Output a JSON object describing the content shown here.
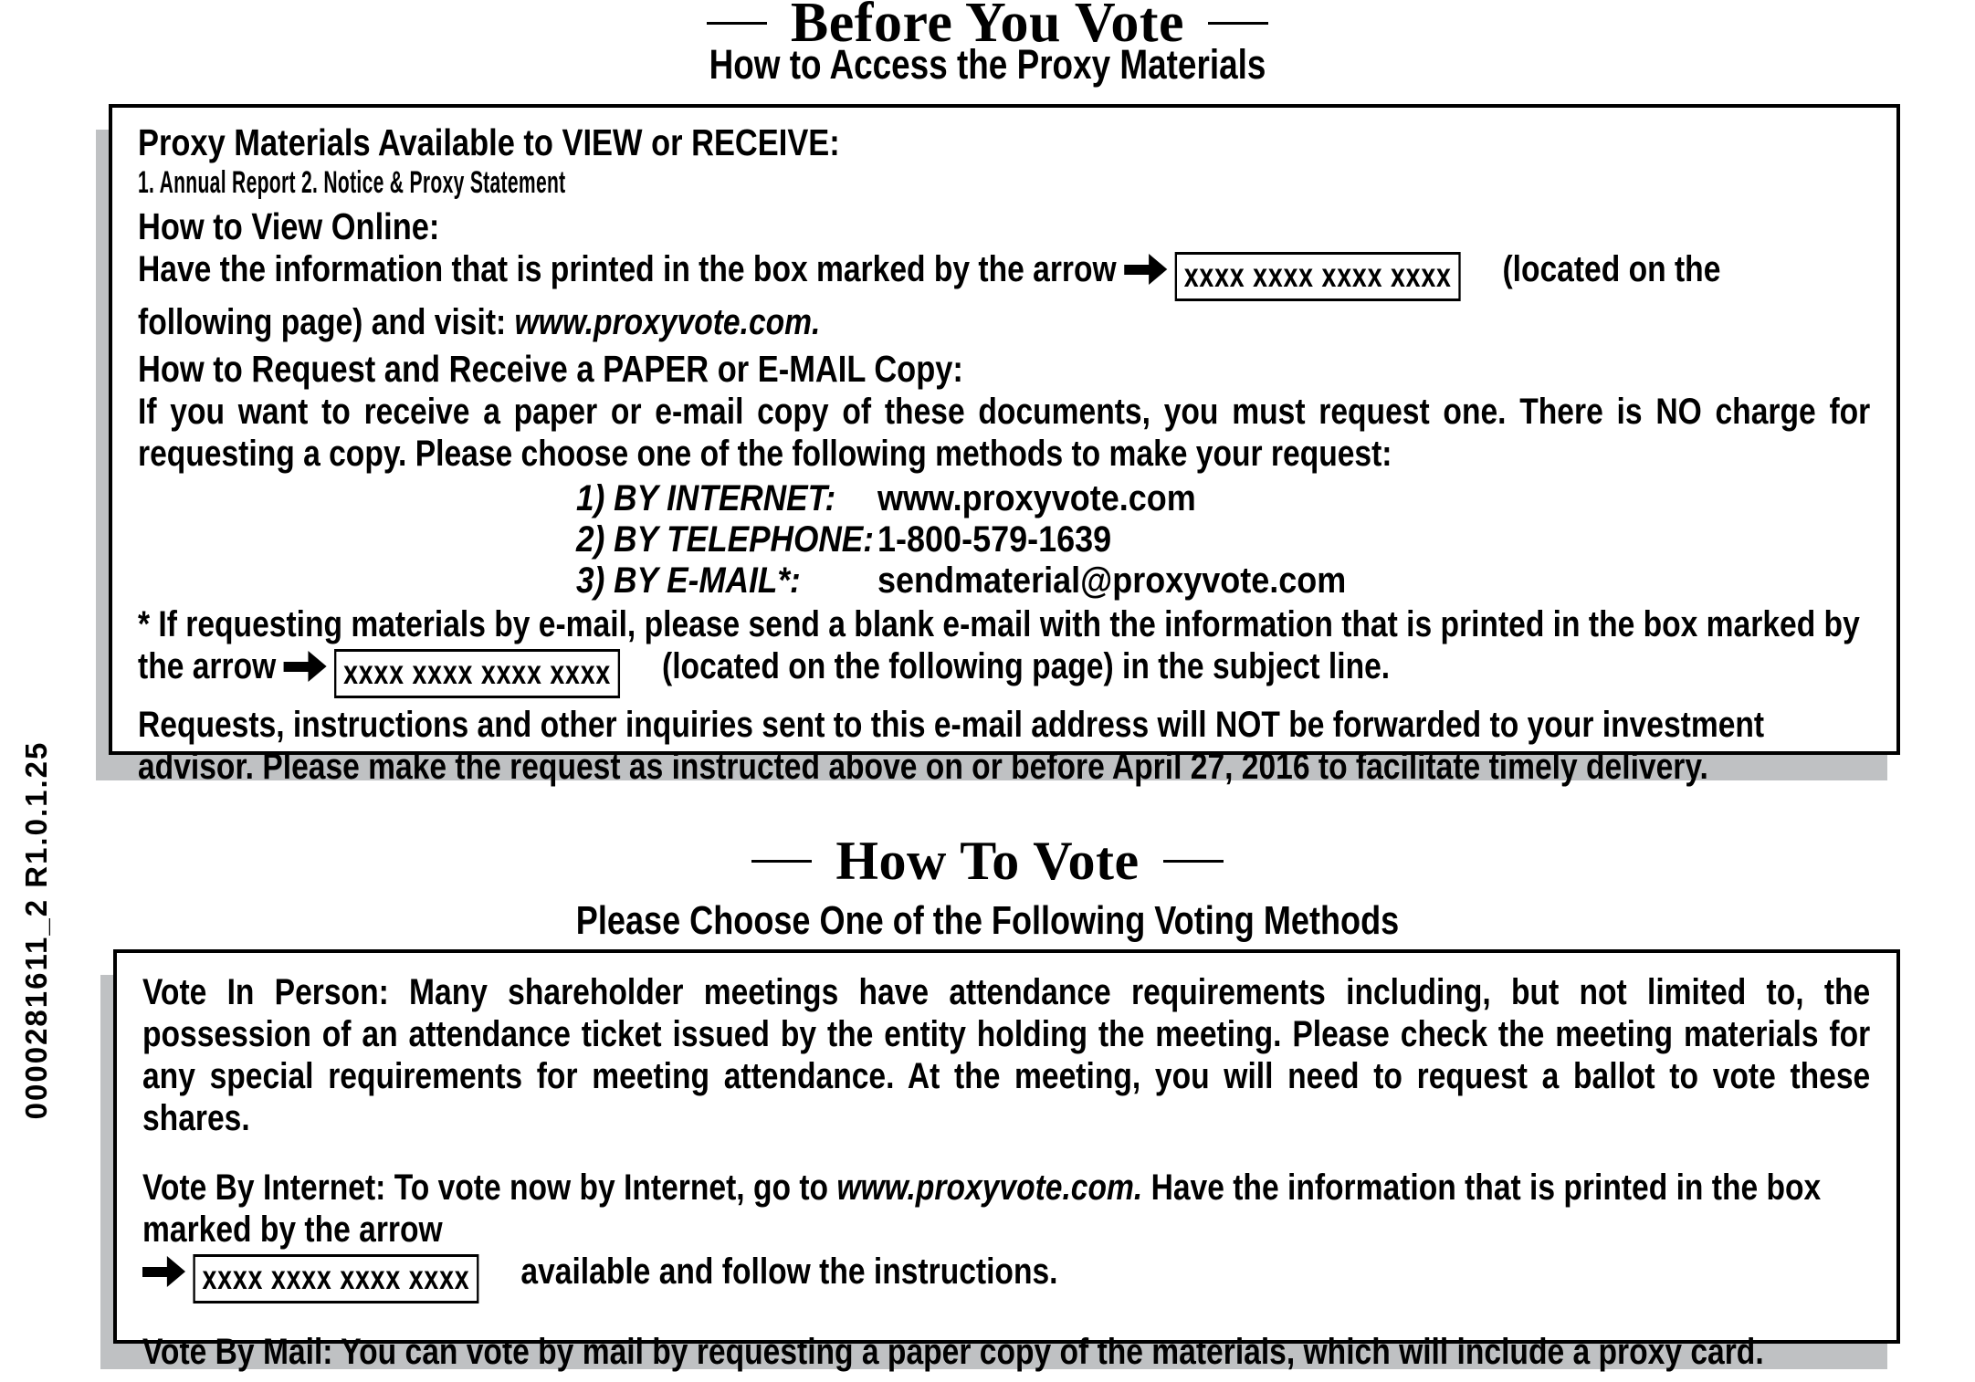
{
  "document": {
    "side_code": "0000281611_2    R1.0.1.25"
  },
  "section_before_you_vote": {
    "title": "Before You Vote",
    "subtitle": "How to Access the Proxy Materials",
    "panel": {
      "available_heading": "Proxy Materials Available to VIEW or RECEIVE:",
      "available_items": "1. Annual Report     2. Notice & Proxy Statement",
      "view_online_heading": "How to View Online:",
      "view_online_text_1": "Have the information that is printed in the box marked by the arrow",
      "view_online_code": "xxxx xxxx xxxx xxxx",
      "view_online_text_2": "(located on the",
      "view_online_text_3": "following page) and visit:",
      "view_online_url": "www.proxyvote.com.",
      "request_heading": "How to Request and Receive a PAPER or E-MAIL Copy:",
      "request_text": "If you want to receive a paper or e-mail copy of these documents, you must request one.  There is NO charge for requesting a copy.  Please choose one of the following methods to make your request:",
      "methods": [
        {
          "label": "1) BY INTERNET:",
          "value": "www.proxyvote.com"
        },
        {
          "label": "2) BY TELEPHONE:",
          "value": "1-800-579-1639"
        },
        {
          "label": "3) BY E-MAIL*:",
          "value": "sendmaterial@proxyvote.com"
        }
      ],
      "footnote_text_1": "*   If requesting materials by e-mail, please send a blank e-mail with the information that is printed in the box marked by the arrow",
      "footnote_code": "xxxx xxxx xxxx xxxx",
      "footnote_text_2": "(located on the following page) in the subject line.",
      "closing_text": "Requests, instructions and other inquiries sent to this e-mail address will NOT be forwarded to your investment advisor. Please make the request as instructed above on or before April 27, 2016 to facilitate timely delivery."
    }
  },
  "section_how_to_vote": {
    "title": "How To Vote",
    "subtitle": "Please Choose One of the Following Voting Methods",
    "panel": {
      "in_person_label": "Vote In Person:",
      "in_person_text": "Many shareholder meetings have attendance requirements including, but not limited to, the possession of an attendance ticket issued by the entity holding the meeting. Please check the meeting materials for any special requirements for meeting attendance. At the meeting, you will need to request a ballot to vote these shares.",
      "by_internet_label": "Vote By Internet:",
      "by_internet_text_1": "To vote now by Internet, go to",
      "by_internet_url": "www.proxyvote.com.",
      "by_internet_text_2": "Have the information that is printed in the box marked by the arrow",
      "by_internet_code": "xxxx xxxx xxxx xxxx",
      "by_internet_text_3": "available and follow the instructions.",
      "by_mail_label": "Vote By Mail:",
      "by_mail_text": "You can vote by mail by requesting a paper copy of the materials, which will include a proxy card."
    }
  },
  "icons": {
    "arrow_right": "arrow-right-icon",
    "rule": "horizontal-rule-decoration"
  },
  "colors": {
    "ink": "#000000",
    "paper": "#ffffff",
    "shadow": "#bfc1c3"
  }
}
